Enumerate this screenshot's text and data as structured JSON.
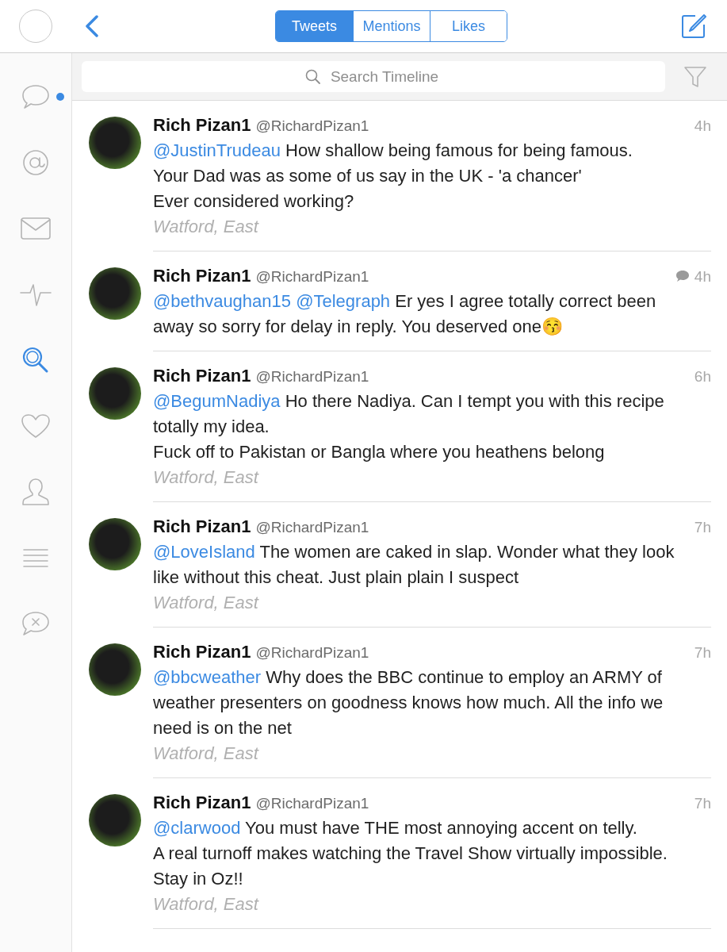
{
  "tabs": [
    {
      "label": "Tweets",
      "selected": true
    },
    {
      "label": "Mentions",
      "selected": false
    },
    {
      "label": "Likes",
      "selected": false
    }
  ],
  "sidebar": {
    "items": [
      {
        "kind": "bubble",
        "selected": false,
        "unread": true
      },
      {
        "kind": "at",
        "selected": false,
        "unread": false
      },
      {
        "kind": "mail",
        "selected": false,
        "unread": false
      },
      {
        "kind": "pulse",
        "selected": false,
        "unread": false
      },
      {
        "kind": "search",
        "selected": true,
        "unread": false
      },
      {
        "kind": "heart",
        "selected": false,
        "unread": false
      },
      {
        "kind": "person",
        "selected": false,
        "unread": false
      },
      {
        "kind": "lines",
        "selected": false,
        "unread": false
      },
      {
        "kind": "mute",
        "selected": false,
        "unread": false
      }
    ]
  },
  "search": {
    "placeholder": "Search Timeline"
  },
  "tweets": [
    {
      "name": "Rich Pizan1",
      "handle": "@RichardPizan1",
      "time": "4h",
      "conversation": false,
      "mention": "@JustinTrudeau",
      "text": "How shallow being famous for being famous.\nYour Dad was as some of us say in the UK - 'a chancer'\nEver considered working?",
      "location": "Watford, East"
    },
    {
      "name": "Rich Pizan1",
      "handle": "@RichardPizan1",
      "time": "4h",
      "conversation": true,
      "mention": "@bethvaughan15 @Telegraph",
      "text": "Er yes I agree totally correct been away so sorry for delay in reply. You deserved one😚"
    },
    {
      "name": "Rich Pizan1",
      "handle": "@RichardPizan1",
      "time": "6h",
      "conversation": false,
      "mention": "@BegumNadiya",
      "text": "Ho there Nadiya. Can I tempt you with this recipe totally my idea.\nFuck off to Pakistan or Bangla where you heathens belong",
      "location": "Watford, East"
    },
    {
      "name": "Rich Pizan1",
      "handle": "@RichardPizan1",
      "time": "7h",
      "conversation": false,
      "mention": "@LoveIsland",
      "text": "The women are caked in slap. Wonder what they look like without this cheat. Just plain plain I suspect",
      "location": "Watford, East"
    },
    {
      "name": "Rich Pizan1",
      "handle": "@RichardPizan1",
      "time": "7h",
      "conversation": false,
      "mention": "@bbcweather",
      "text": "Why does the BBC continue to employ an ARMY of weather presenters on goodness knows how much. All the info we need is on the net",
      "location": "Watford, East"
    },
    {
      "name": "Rich Pizan1",
      "handle": "@RichardPizan1",
      "time": "7h",
      "conversation": false,
      "mention": "@clarwood",
      "text": "You must have THE most annoying accent on telly.\nA real turnoff makes watching the Travel Show virtually impossible. Stay in Oz!!",
      "location": "Watford, East"
    }
  ]
}
